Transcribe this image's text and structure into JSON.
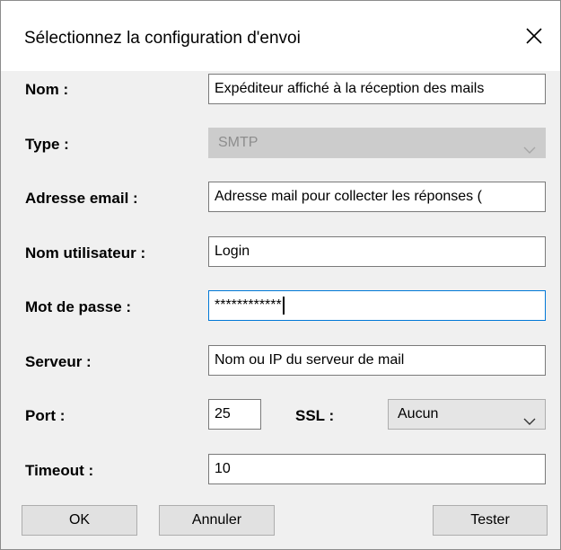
{
  "window": {
    "title": "Sélectionnez la configuration d'envoi"
  },
  "icons": {
    "close": "close-icon",
    "dropdown": "chevron-down-icon"
  },
  "colors": {
    "focus_border": "#0078d7",
    "disabled_bg": "#cccccc",
    "button_bg": "#e1e1e1"
  },
  "form": {
    "nom": {
      "label": "Nom :",
      "value": "Expéditeur affiché à la réception des mails"
    },
    "type": {
      "label": "Type :",
      "value": "SMTP",
      "disabled": true
    },
    "email": {
      "label": "Adresse email :",
      "value": "Adresse mail pour collecter les réponses ("
    },
    "user": {
      "label": "Nom utilisateur :",
      "value": "Login"
    },
    "password": {
      "label": "Mot de passe :",
      "value": "************"
    },
    "server": {
      "label": "Serveur :",
      "value": "Nom ou IP du serveur de mail"
    },
    "port": {
      "label": "Port :",
      "value": "25"
    },
    "ssl": {
      "label": "SSL :",
      "value": "Aucun"
    },
    "timeout": {
      "label": "Timeout :",
      "value": "10"
    }
  },
  "buttons": {
    "ok": "OK",
    "cancel": "Annuler",
    "test": "Tester"
  }
}
